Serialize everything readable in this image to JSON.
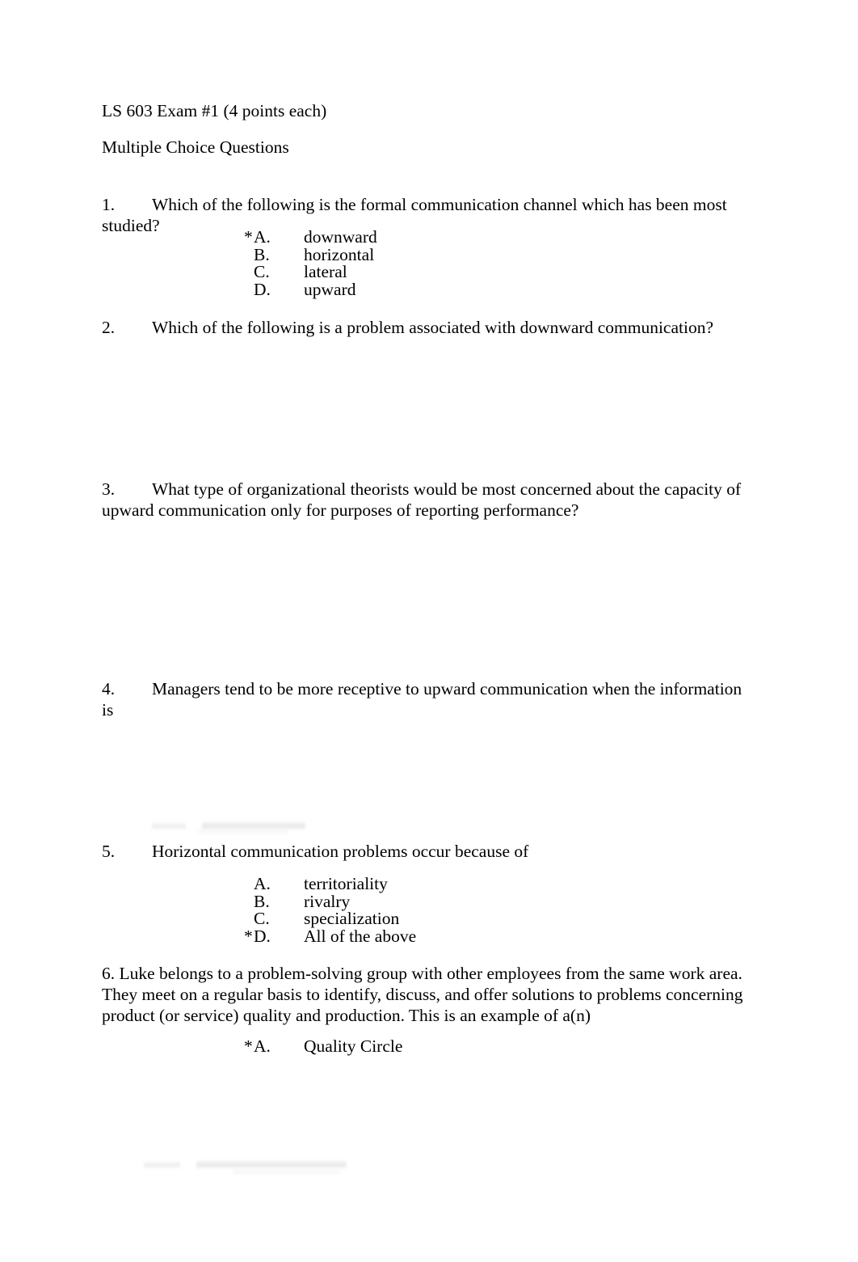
{
  "document": {
    "title_line": "LS 603 Exam #1 (4 points each)",
    "subtitle_line": "Multiple Choice Questions",
    "questions": [
      {
        "number": "1.",
        "stem": "Which of the following is the formal communication channel which has been most studied?",
        "options": [
          {
            "mark": "*",
            "letter": "A.",
            "text": "downward"
          },
          {
            "mark": "",
            "letter": "B.",
            "text": "horizontal"
          },
          {
            "mark": "",
            "letter": "C.",
            "text": "lateral"
          },
          {
            "mark": "",
            "letter": "D.",
            "text": "upward"
          }
        ]
      },
      {
        "number": "2.",
        "stem": "Which of the following is a problem associated with downward communication?",
        "options": []
      },
      {
        "number": "3.",
        "stem": "What type of organizational theorists would be most concerned about the capacity of upward communication only for purposes of reporting performance?",
        "options": []
      },
      {
        "number": "4.",
        "stem": "Managers tend to be more receptive to upward communication when the information is",
        "options": []
      },
      {
        "number": "5.",
        "stem": "Horizontal communication problems occur because of",
        "options": [
          {
            "mark": "",
            "letter": "A.",
            "text": "territoriality"
          },
          {
            "mark": "",
            "letter": "B.",
            "text": "rivalry"
          },
          {
            "mark": "",
            "letter": "C.",
            "text": "specialization"
          },
          {
            "mark": "*",
            "letter": "D.",
            "text": "All of the above"
          }
        ]
      },
      {
        "number": "6.",
        "stem": "Luke belongs to a problem-solving group with other employees from the same work area.  They meet on a regular basis to identify, discuss, and offer solutions to problems concerning product (or service) quality and production.  This is an example of a(n)",
        "options": [
          {
            "mark": "*",
            "letter": "A.",
            "text": "Quality Circle"
          }
        ]
      }
    ]
  }
}
